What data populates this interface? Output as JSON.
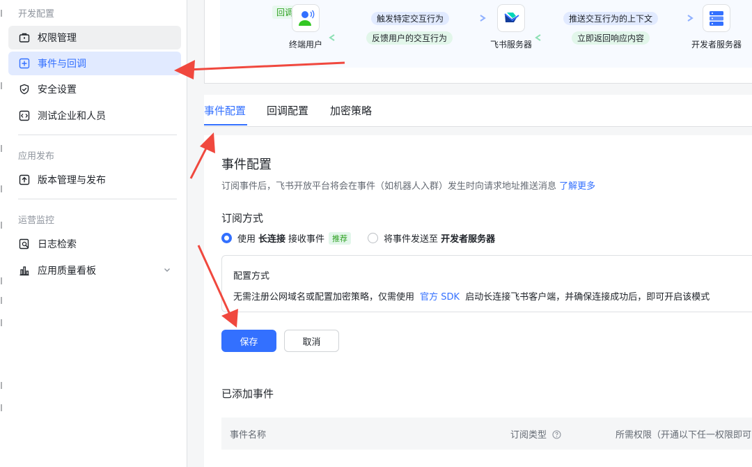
{
  "sidebar": {
    "groups": [
      {
        "title": "开发配置"
      },
      {
        "title": "应用发布"
      },
      {
        "title": "运营监控"
      }
    ],
    "items": [
      {
        "label": "权限管理",
        "icon": "briefcase-icon"
      },
      {
        "label": "事件与回调",
        "icon": "event-plus-icon"
      },
      {
        "label": "安全设置",
        "icon": "shield-check-icon"
      },
      {
        "label": "测试企业和人员",
        "icon": "code-icon"
      },
      {
        "label": "版本管理与发布",
        "icon": "upload-icon"
      },
      {
        "label": "日志检索",
        "icon": "log-search-icon"
      },
      {
        "label": "应用质量看板",
        "icon": "bar-chart-icon"
      }
    ]
  },
  "flow": {
    "badge": "回调",
    "nodes": [
      {
        "label": "终端用户",
        "icon": "user-icon"
      },
      {
        "label": "飞书服务器",
        "icon": "feishu-logo-icon"
      },
      {
        "label": "开发者服务器",
        "icon": "server-icon"
      }
    ],
    "arrows": {
      "trigger": "触发特定交互行为",
      "feedback": "反馈用户的交互行为",
      "push": "推送交互行为的上下文",
      "reply": "立即返回响应内容"
    }
  },
  "tabs": [
    {
      "label": "事件配置"
    },
    {
      "label": "回调配置"
    },
    {
      "label": "加密策略"
    }
  ],
  "panel": {
    "title": "事件配置",
    "desc": "订阅事件后，飞书开放平台将会在事件（如机器人入群）发生时向请求地址推送消息",
    "learn_more": "了解更多",
    "subscribe_title": "订阅方式",
    "option1": {
      "pre": "使用",
      "bold": "长连接",
      "post": "接收事件",
      "tag": "推荐"
    },
    "option2": {
      "pre": "将事件发送至",
      "bold": "开发者服务器"
    },
    "config": {
      "title": "配置方式",
      "desc_pre": "无需注册公网域名或配置加密策略，仅需使用",
      "link": "官方 SDK",
      "desc_post": "启动长连接飞书客户端，并确保连接成功后，即可开启该模式"
    },
    "save": "保存",
    "cancel": "取消",
    "added_title": "已添加事件",
    "table_headers": {
      "name": "事件名称",
      "type": "订阅类型",
      "perm": "所需权限（开通以下任一权限即可"
    }
  },
  "colors": {
    "accent": "#3370ff",
    "annotation": "#f0483e",
    "success": "#2ea121"
  }
}
